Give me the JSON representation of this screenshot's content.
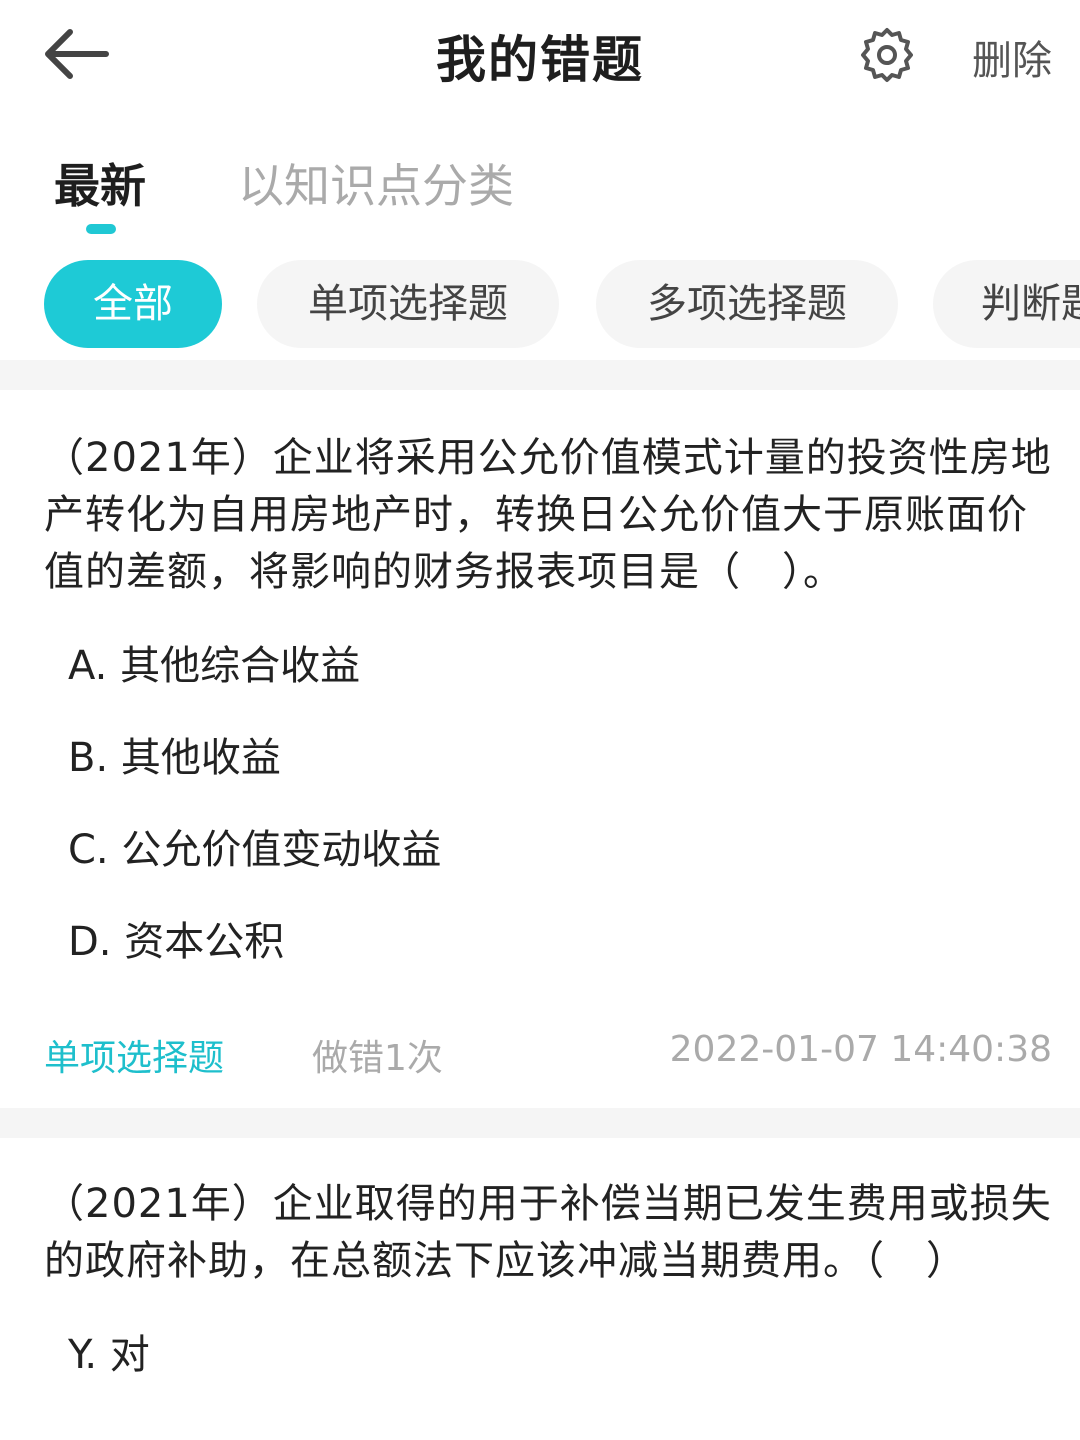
{
  "header": {
    "title": "我的错题",
    "delete_label": "删除"
  },
  "tabs": [
    {
      "label": "最新",
      "active": true
    },
    {
      "label": "以知识点分类",
      "active": false
    }
  ],
  "filters": [
    {
      "label": "全部",
      "active": true
    },
    {
      "label": "单项选择题",
      "active": false
    },
    {
      "label": "多项选择题",
      "active": false
    },
    {
      "label": "判断题",
      "active": false
    }
  ],
  "colors": {
    "accent": "#1ecad6",
    "type_text": "#1ebfcc",
    "muted": "#aaaaaa"
  },
  "questions": [
    {
      "stem": "（2021年）企业将采用公允价值模式计量的投资性房地产转化为自用房地产时，转换日公允价值大于原账面价值的差额，将影响的财务报表项目是（　）。",
      "options": [
        "A. 其他综合收益",
        "B. 其他收益",
        "C. 公允价值变动收益",
        "D. 资本公积"
      ],
      "type": "单项选择题",
      "wrong_count": "做错1次",
      "time": "2022-01-07 14:40:38"
    },
    {
      "stem": "（2021年）企业取得的用于补偿当期已发生费用或损失的政府补助，在总额法下应该冲减当期费用。（　）",
      "options": [
        "Y. 对"
      ]
    }
  ]
}
